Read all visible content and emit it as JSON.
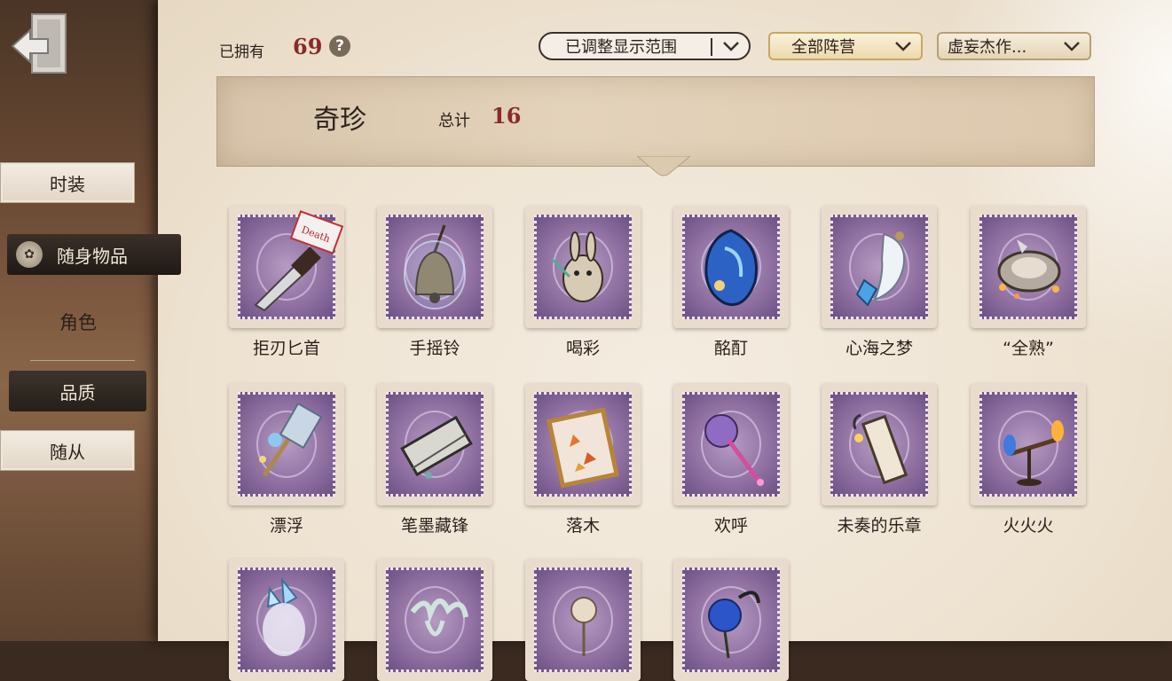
{
  "header": {
    "owned_label": "已拥有",
    "owned_count": "69",
    "help_symbol": "?",
    "filters": {
      "range": "已调整显示范围",
      "faction": "全部阵营",
      "series": "虚妄杰作..."
    }
  },
  "sidebar": {
    "items": [
      {
        "label": "时装"
      },
      {
        "label": "随身物品"
      },
      {
        "label": "角色"
      },
      {
        "label": "品质"
      },
      {
        "label": "随从"
      }
    ]
  },
  "category": {
    "title": "奇珍",
    "total_label": "总计",
    "total_count": "16"
  },
  "items": [
    {
      "name": "拒刃匕首",
      "icon": "dagger-icon"
    },
    {
      "name": "手摇铃",
      "icon": "bell-icon"
    },
    {
      "name": "喝彩",
      "icon": "rabbit-toy-icon"
    },
    {
      "name": "酩酊",
      "icon": "blue-gem-icon"
    },
    {
      "name": "心海之梦",
      "icon": "crystal-pendant-icon"
    },
    {
      "name": "“全熟”",
      "icon": "pan-icon"
    },
    {
      "name": "漂浮",
      "icon": "lantern-staff-icon"
    },
    {
      "name": "笔墨藏锋",
      "icon": "scroll-icon"
    },
    {
      "name": "落木",
      "icon": "leaf-frame-icon"
    },
    {
      "name": "欢呼",
      "icon": "pom-pom-icon"
    },
    {
      "name": "未奏的乐章",
      "icon": "music-roll-icon"
    },
    {
      "name": "火火火",
      "icon": "torch-icon"
    },
    {
      "name": "",
      "icon": "ice-flower-icon"
    },
    {
      "name": "",
      "icon": "antler-icon"
    },
    {
      "name": "",
      "icon": "trinket-icon"
    },
    {
      "name": "",
      "icon": "blue-rose-icon"
    }
  ],
  "colors": {
    "accent_red": "#8a2a2a",
    "stamp_purple": "#8e6fa0",
    "dark_tab": "#262019"
  }
}
